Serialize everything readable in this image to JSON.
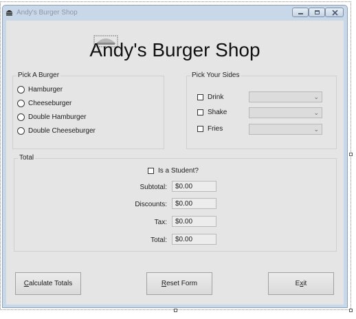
{
  "window": {
    "title": "Andy's Burger Shop"
  },
  "header": {
    "title": "Andy's Burger Shop"
  },
  "burger_group": {
    "legend": "Pick A Burger",
    "options": [
      "Hamburger",
      "Cheeseburger",
      "Double Hamburger",
      "Double Cheeseburger"
    ]
  },
  "sides_group": {
    "legend": "Pick Your Sides",
    "items": [
      {
        "label": "Drink",
        "selected": ""
      },
      {
        "label": "Shake",
        "selected": ""
      },
      {
        "label": "Fries",
        "selected": ""
      }
    ]
  },
  "totals_group": {
    "legend": "Total",
    "student_label": "Is a Student?",
    "fields": [
      {
        "label": "Subtotal:",
        "value": "$0.00"
      },
      {
        "label": "Discounts:",
        "value": "$0.00"
      },
      {
        "label": "Tax:",
        "value": "$0.00"
      },
      {
        "label": "Total:",
        "value": "$0.00"
      }
    ]
  },
  "buttons": {
    "calculate": {
      "accel": "C",
      "rest": "alculate Totals"
    },
    "reset": {
      "accel": "R",
      "rest": "eset Form"
    },
    "exit": {
      "pre": "E",
      "accel": "x",
      "rest": "it"
    }
  },
  "icons": {
    "app": "burger-icon",
    "minimize": "minimize-icon",
    "maximize": "maximize-icon",
    "close": "close-icon"
  }
}
